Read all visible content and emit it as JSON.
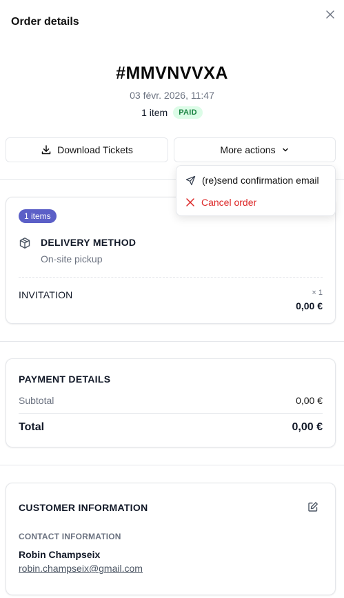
{
  "header": {
    "title": "Order details"
  },
  "order": {
    "code": "#MMVNVVXA",
    "date": "03 févr. 2026, 11:47",
    "item_count": "1 item",
    "status": "PAID"
  },
  "actions": {
    "download_label": "Download Tickets",
    "more_label": "More actions"
  },
  "dropdown": {
    "items": [
      {
        "label": "(re)send confirmation email",
        "icon": "send-icon"
      },
      {
        "label": "Cancel order",
        "icon": "close-icon",
        "color": "#dc2626"
      }
    ]
  },
  "items_card": {
    "badge": "1 items",
    "delivery_title": "DELIVERY METHOD",
    "delivery_value": "On-site pickup",
    "line_items": [
      {
        "name": "INVITATION",
        "quantity": "× 1",
        "price": "0,00 €"
      }
    ]
  },
  "payment": {
    "title": "PAYMENT DETAILS",
    "subtotal_label": "Subtotal",
    "subtotal_value": "0,00 €",
    "total_label": "Total",
    "total_value": "0,00 €"
  },
  "customer": {
    "title": "CUSTOMER INFORMATION",
    "contact_label": "CONTACT INFORMATION",
    "name": "Robin Champseix",
    "email": "robin.champseix@gmail.com"
  },
  "colors": {
    "accent": "#5b5fc7",
    "paid_bg": "#dcfce7",
    "paid_text": "#15803d",
    "danger": "#dc2626"
  }
}
